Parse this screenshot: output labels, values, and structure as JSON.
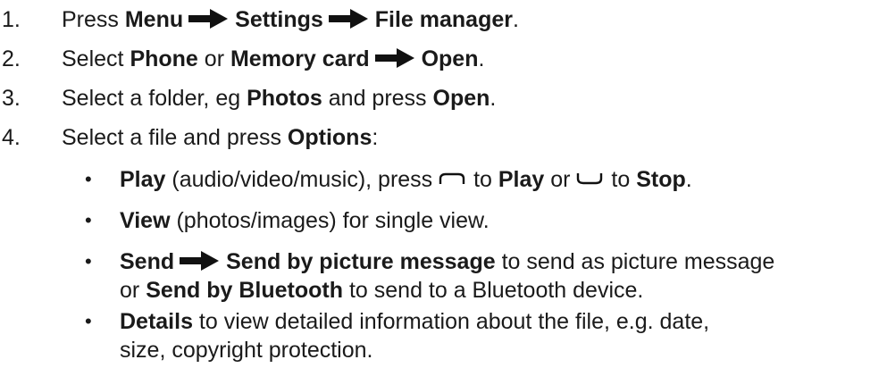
{
  "steps": [
    {
      "number": "1.",
      "parts": [
        "Press ",
        "Menu",
        "Settings",
        "File manager",
        "."
      ]
    },
    {
      "number": "2.",
      "parts": [
        "Select ",
        "Phone",
        " or ",
        "Memory card",
        "Open",
        "."
      ]
    },
    {
      "number": "3.",
      "parts": [
        "Select a folder, eg ",
        "Photos",
        " and press ",
        "Open",
        "."
      ]
    },
    {
      "number": "4.",
      "parts": [
        "Select a file and press ",
        "Options",
        ":"
      ]
    }
  ],
  "options": [
    {
      "bullet": "•",
      "parts": [
        "Play",
        " (audio/video/music), press ",
        " to ",
        "Play",
        " or ",
        " to ",
        "Stop",
        "."
      ]
    },
    {
      "bullet": "•",
      "parts": [
        "View",
        " (photos/images) for single view."
      ]
    },
    {
      "bullet": "•",
      "parts": [
        "Send",
        "Send by picture message",
        " to send as picture message"
      ],
      "cont": [
        "or ",
        "Send by Bluetooth",
        " to send to a Bluetooth device."
      ]
    },
    {
      "bullet": "•",
      "parts": [
        "Details",
        " to view detailed information about the file, e.g. date,"
      ],
      "cont": [
        "size, copyright protection."
      ]
    }
  ],
  "icons": {
    "arrow": "right-arrow-icon",
    "left_softkey": "left-softkey-icon",
    "right_softkey": "right-softkey-icon"
  }
}
